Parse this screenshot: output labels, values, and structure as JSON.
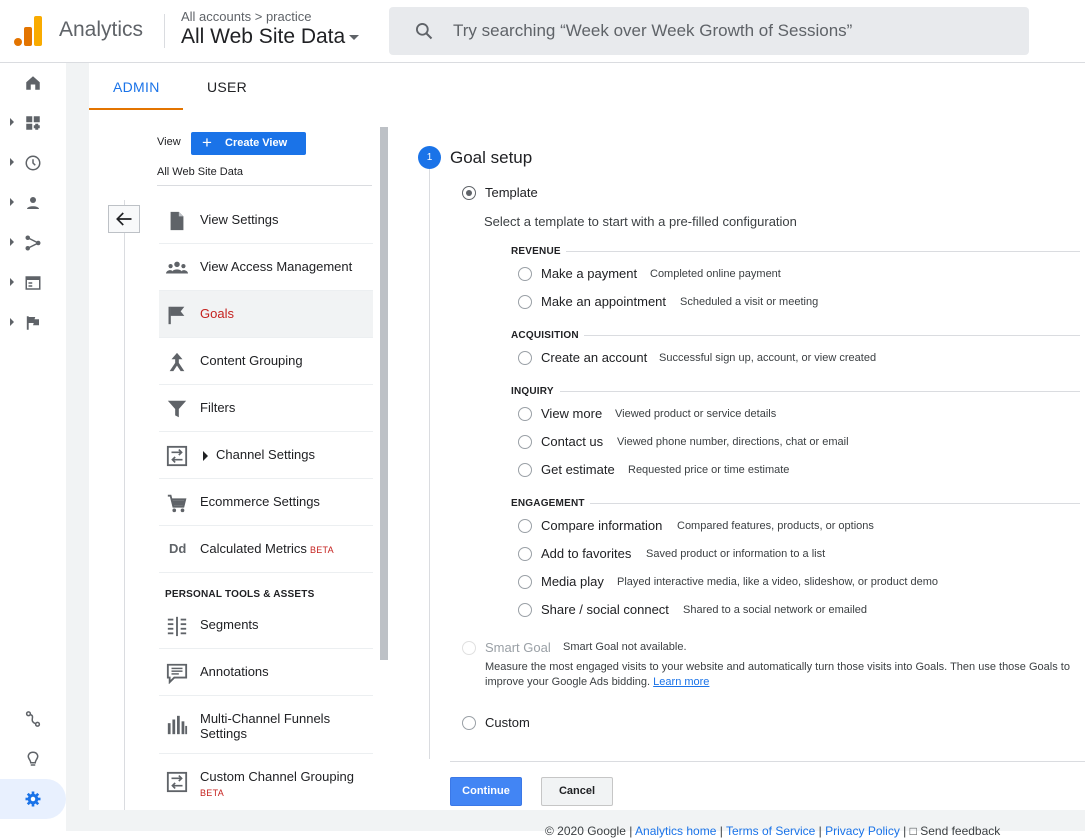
{
  "header": {
    "app_name": "Analytics",
    "breadcrumb_accounts": "All accounts",
    "breadcrumb_account": "practice",
    "property_name": "All Web Site Data",
    "search_placeholder": "Try searching “Week over Week Growth of Sessions”"
  },
  "left_nav": [
    {
      "name": "home",
      "icon": "home-icon"
    },
    {
      "name": "customization",
      "icon": "dashboard-icon"
    },
    {
      "name": "realtime",
      "icon": "clock-icon"
    },
    {
      "name": "audience",
      "icon": "person-icon"
    },
    {
      "name": "acquisition",
      "icon": "acquisition-icon"
    },
    {
      "name": "behavior",
      "icon": "behavior-icon"
    },
    {
      "name": "conversions",
      "icon": "flag-icon"
    },
    {
      "name": "attribution",
      "icon": "attribution-icon"
    },
    {
      "name": "discover",
      "icon": "lightbulb-icon"
    },
    {
      "name": "admin",
      "icon": "gear-icon"
    }
  ],
  "tabs": {
    "admin": "ADMIN",
    "user": "USER"
  },
  "view_column": {
    "view_label": "View",
    "create_view": "Create View",
    "view_name": "All Web Site Data",
    "items": [
      {
        "label": "View Settings",
        "icon": "document-icon"
      },
      {
        "label": "View Access Management",
        "icon": "people-icon"
      },
      {
        "label": "Goals",
        "icon": "flag-icon"
      },
      {
        "label": "Content Grouping",
        "icon": "content-grouping-icon"
      },
      {
        "label": "Filters",
        "icon": "filter-icon"
      },
      {
        "label": "Channel Settings",
        "icon": "channel-settings-icon"
      },
      {
        "label": "Ecommerce Settings",
        "icon": "cart-icon"
      },
      {
        "label": "Calculated Metrics",
        "icon": "calculated-metrics-icon",
        "badge": "BETA"
      }
    ],
    "section_personal": "PERSONAL TOOLS & ASSETS",
    "personal_items": [
      {
        "label": "Segments",
        "icon": "segments-icon"
      },
      {
        "label": "Annotations",
        "icon": "annotations-icon"
      },
      {
        "label": "Multi-Channel Funnels Settings",
        "label_line1": "Multi-Channel Funnels",
        "label_line2": "Settings",
        "icon": "funnels-icon"
      },
      {
        "label": "Custom Channel Grouping",
        "icon": "custom-channel-icon",
        "badge": "BETA"
      }
    ]
  },
  "goal_setup": {
    "step_number": "1",
    "title": "Goal setup",
    "template_label": "Template",
    "template_desc": "Select a template to start with a pre-filled configuration",
    "categories": [
      {
        "name": "REVENUE",
        "goals": [
          {
            "name": "Make a payment",
            "desc": "Completed online payment"
          },
          {
            "name": "Make an appointment",
            "desc": "Scheduled a visit or meeting"
          }
        ]
      },
      {
        "name": "ACQUISITION",
        "goals": [
          {
            "name": "Create an account",
            "desc": "Successful sign up, account, or view created"
          }
        ]
      },
      {
        "name": "INQUIRY",
        "goals": [
          {
            "name": "View more",
            "desc": "Viewed product or service details"
          },
          {
            "name": "Contact us",
            "desc": "Viewed phone number, directions, chat or email"
          },
          {
            "name": "Get estimate",
            "desc": "Requested price or time estimate"
          }
        ]
      },
      {
        "name": "ENGAGEMENT",
        "goals": [
          {
            "name": "Compare information",
            "desc": "Compared features, products, or options"
          },
          {
            "name": "Add to favorites",
            "desc": "Saved product or information to a list"
          },
          {
            "name": "Media play",
            "desc": "Played interactive media, like a video, slideshow, or product demo"
          },
          {
            "name": "Share / social connect",
            "desc": "Shared to a social network or emailed"
          }
        ]
      }
    ],
    "smart_goal_label": "Smart Goal",
    "smart_goal_note": "Smart Goal not available.",
    "smart_goal_desc": "Measure the most engaged visits to your website and automatically turn those visits into Goals. Then use those Goals to improve your Google Ads bidding.",
    "learn_more": "Learn more",
    "custom_label": "Custom",
    "continue": "Continue",
    "cancel": "Cancel"
  },
  "footer": {
    "copyright": "© 2020 Google",
    "links": [
      "Analytics home",
      "Terms of Service",
      "Privacy Policy",
      "Send feedback"
    ]
  },
  "colors": {
    "accent": "#1a73e8",
    "active_goal": "#c5221f",
    "tab_underline": "#e37400"
  }
}
